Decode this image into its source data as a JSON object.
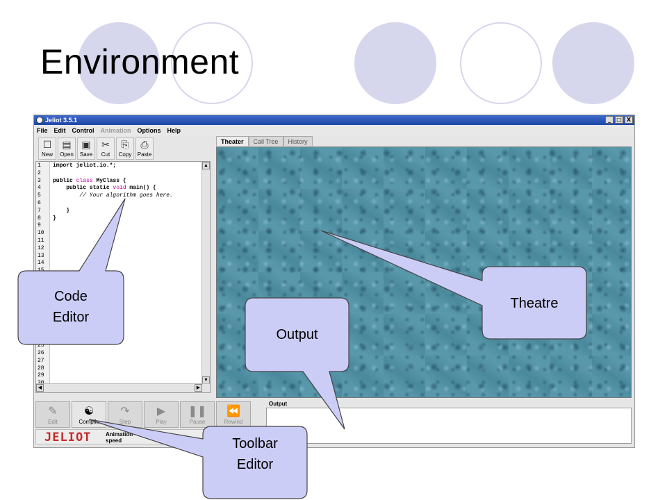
{
  "slide": {
    "title": "Environment"
  },
  "window": {
    "title": "Jeliot 3.5.1",
    "controls": [
      "_",
      "□",
      "X"
    ]
  },
  "menubar": {
    "items": [
      {
        "label": "File",
        "enabled": true
      },
      {
        "label": "Edit",
        "enabled": true
      },
      {
        "label": "Control",
        "enabled": true
      },
      {
        "label": "Animation",
        "enabled": false
      },
      {
        "label": "Options",
        "enabled": true
      },
      {
        "label": "Help",
        "enabled": true
      }
    ]
  },
  "editor_toolbar": {
    "buttons": [
      {
        "label": "New",
        "icon": "new-file-icon",
        "glyph": "☐"
      },
      {
        "label": "Open",
        "icon": "open-folder-icon",
        "glyph": "▤"
      },
      {
        "label": "Save",
        "icon": "save-icon",
        "glyph": "▣"
      },
      {
        "label": "Cut",
        "icon": "scissors-icon",
        "glyph": "✂"
      },
      {
        "label": "Copy",
        "icon": "copy-icon",
        "glyph": "⎘"
      },
      {
        "label": "Paste",
        "icon": "paste-icon",
        "glyph": "⎙"
      }
    ]
  },
  "editor": {
    "line_count": 30,
    "code_lines": [
      [
        {
          "t": "import jeliot.io.*;",
          "c": "normal"
        }
      ],
      [],
      [
        {
          "t": "public ",
          "c": "normal"
        },
        {
          "t": "class",
          "c": "kw"
        },
        {
          "t": " MyClass {",
          "c": "normal"
        }
      ],
      [
        {
          "t": "    public static ",
          "c": "normal"
        },
        {
          "t": "void",
          "c": "kw"
        },
        {
          "t": " main() {",
          "c": "normal"
        }
      ],
      [
        {
          "t": "        // Your algorithm goes here.",
          "c": "cmt"
        }
      ],
      [],
      [
        {
          "t": "    }",
          "c": "normal"
        }
      ],
      [
        {
          "t": "}",
          "c": "normal"
        }
      ]
    ]
  },
  "tabs": [
    {
      "label": "Theater",
      "active": true
    },
    {
      "label": "Call Tree",
      "active": false
    },
    {
      "label": "History",
      "active": false
    }
  ],
  "animation_toolbar": {
    "buttons": [
      {
        "label": "Edit",
        "icon": "edit-icon",
        "glyph": "✎",
        "enabled": false
      },
      {
        "label": "Compile",
        "icon": "yin-yang-icon",
        "glyph": "☯",
        "enabled": true
      },
      {
        "label": "Step",
        "icon": "step-icon",
        "glyph": "↷",
        "enabled": false
      },
      {
        "label": "Play",
        "icon": "play-icon",
        "glyph": "▶",
        "enabled": false
      },
      {
        "label": "Pause",
        "icon": "pause-icon",
        "glyph": "❚❚",
        "enabled": false
      },
      {
        "label": "Rewind",
        "icon": "rewind-icon",
        "glyph": "⏪",
        "enabled": false
      }
    ]
  },
  "logo": {
    "text": "JELIOT"
  },
  "speed": {
    "label": "Animation speed"
  },
  "output": {
    "label": "Output"
  },
  "callouts": [
    {
      "id": "code-editor",
      "label": "Code\nEditor"
    },
    {
      "id": "theatre",
      "label": "Theatre"
    },
    {
      "id": "output",
      "label": "Output"
    },
    {
      "id": "toolbar-editor",
      "label": "Toolbar\nEditor"
    }
  ],
  "colors": {
    "accent_circle": "#d6d6ec",
    "callout_fill": "#cccdf7",
    "callout_stroke": "#444444",
    "titlebar": "#1e48a8",
    "keyword": "#c000a0",
    "logo": "#c82828"
  }
}
